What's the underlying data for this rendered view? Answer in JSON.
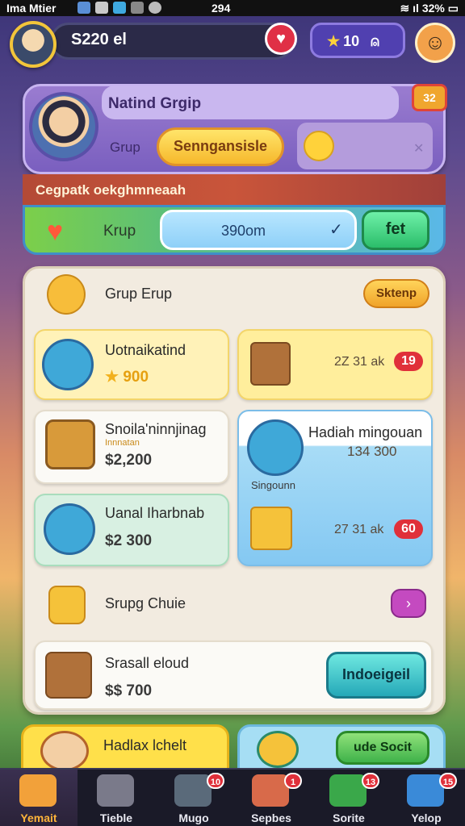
{
  "status_bar": {
    "left": "Ima Mtier",
    "center": "294",
    "right": "32%"
  },
  "hud": {
    "money": "S220 el",
    "stars": "10"
  },
  "profile": {
    "name": "Natind Grgip",
    "group": "Grup",
    "gold_button": "Senngansisle",
    "corner_badge": "32"
  },
  "stripe": {
    "text": "Cegpatk oekghmneaah"
  },
  "search": {
    "label": "Krup",
    "value": "390om",
    "go_button": "fet"
  },
  "panel": {
    "header": {
      "label": "Grup Erup",
      "button": "Sktenp"
    },
    "cards": [
      {
        "title": "Uotnaikatind",
        "value": "900"
      },
      {
        "meta": "2Z 31 ak",
        "badge": "19"
      },
      {
        "title": "Snoila'ninnjinag",
        "subtitle": "Innnatan",
        "value": "$2,200"
      },
      {
        "title": "Hadiah mingouan",
        "value": "134 300",
        "label": "Singounn"
      },
      {
        "title": "Uanal Iharbnab",
        "value": "$2 300"
      },
      {
        "meta": "27 31 ak",
        "badge": "60"
      }
    ],
    "row": {
      "label": "Srupg Chuie"
    },
    "bottom_card": {
      "title": "Srasall eloud",
      "value": "$$ 700",
      "button": "Indoeigeil"
    }
  },
  "bottom": {
    "yellow_title": "Hadlax lchelt",
    "green_button": "ude Socit"
  },
  "nav": [
    {
      "label": "Yemait",
      "badge": ""
    },
    {
      "label": "Tieble",
      "badge": ""
    },
    {
      "label": "Mugo",
      "badge": "10"
    },
    {
      "label": "Sepbes",
      "badge": "1"
    },
    {
      "label": "Sorite",
      "badge": "13"
    },
    {
      "label": "Yelop",
      "badge": "15"
    }
  ]
}
